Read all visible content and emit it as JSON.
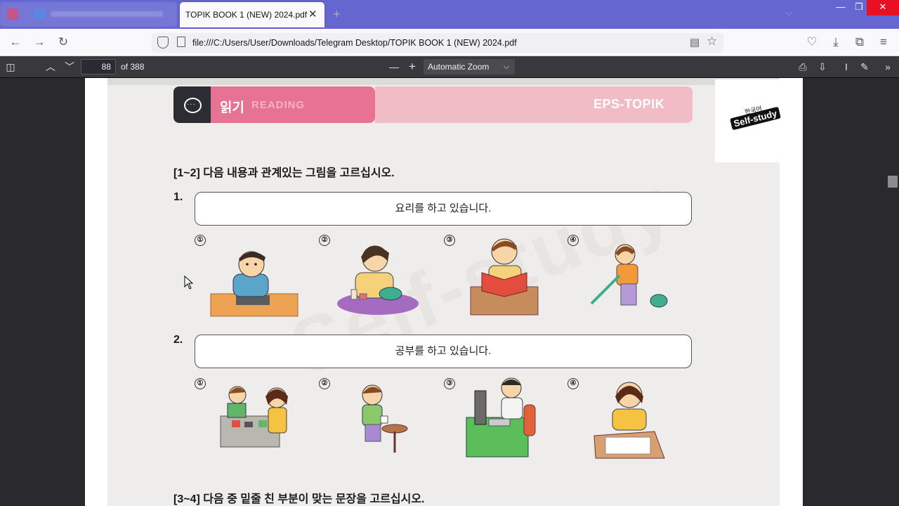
{
  "browser": {
    "active_tab_title": "TOPIK BOOK 1 (NEW) 2024.pdf",
    "tab_close": "✕",
    "new_tab": "+",
    "url": "file:///C:/Users/User/Downloads/Telegram Desktop/TOPIK BOOK 1 (NEW) 2024.pdf",
    "accent_color": "#6566cf"
  },
  "pdf_toolbar": {
    "page_number": "88",
    "page_count": "of 388",
    "zoom": "Automatic Zoom",
    "zoom_out": "—",
    "zoom_in": "+"
  },
  "document": {
    "banner": {
      "korean": "읽기",
      "reading": "READING",
      "brand": "EPS-TOPIK",
      "colors": {
        "dark": "#2b2d33",
        "pink": "#e67393",
        "light_pink": "#f2bcc7"
      }
    },
    "logo": {
      "small": "한국어",
      "main": "Self-study"
    },
    "instruction_1": "[1~2] 다음 내용과 관계있는 그림을 고르십시오.",
    "questions": [
      {
        "number": "1.",
        "text": "요리를 하고 있습니다.",
        "options": [
          "①",
          "②",
          "③",
          "④"
        ]
      },
      {
        "number": "2.",
        "text": "공부를 하고 있습니다.",
        "options": [
          "①",
          "②",
          "③",
          "④"
        ]
      }
    ],
    "instruction_2": "[3~4] 다음 중 밑줄 친 부분이 맞는 문장을 고르십시오.",
    "watermark": "Self-study"
  }
}
